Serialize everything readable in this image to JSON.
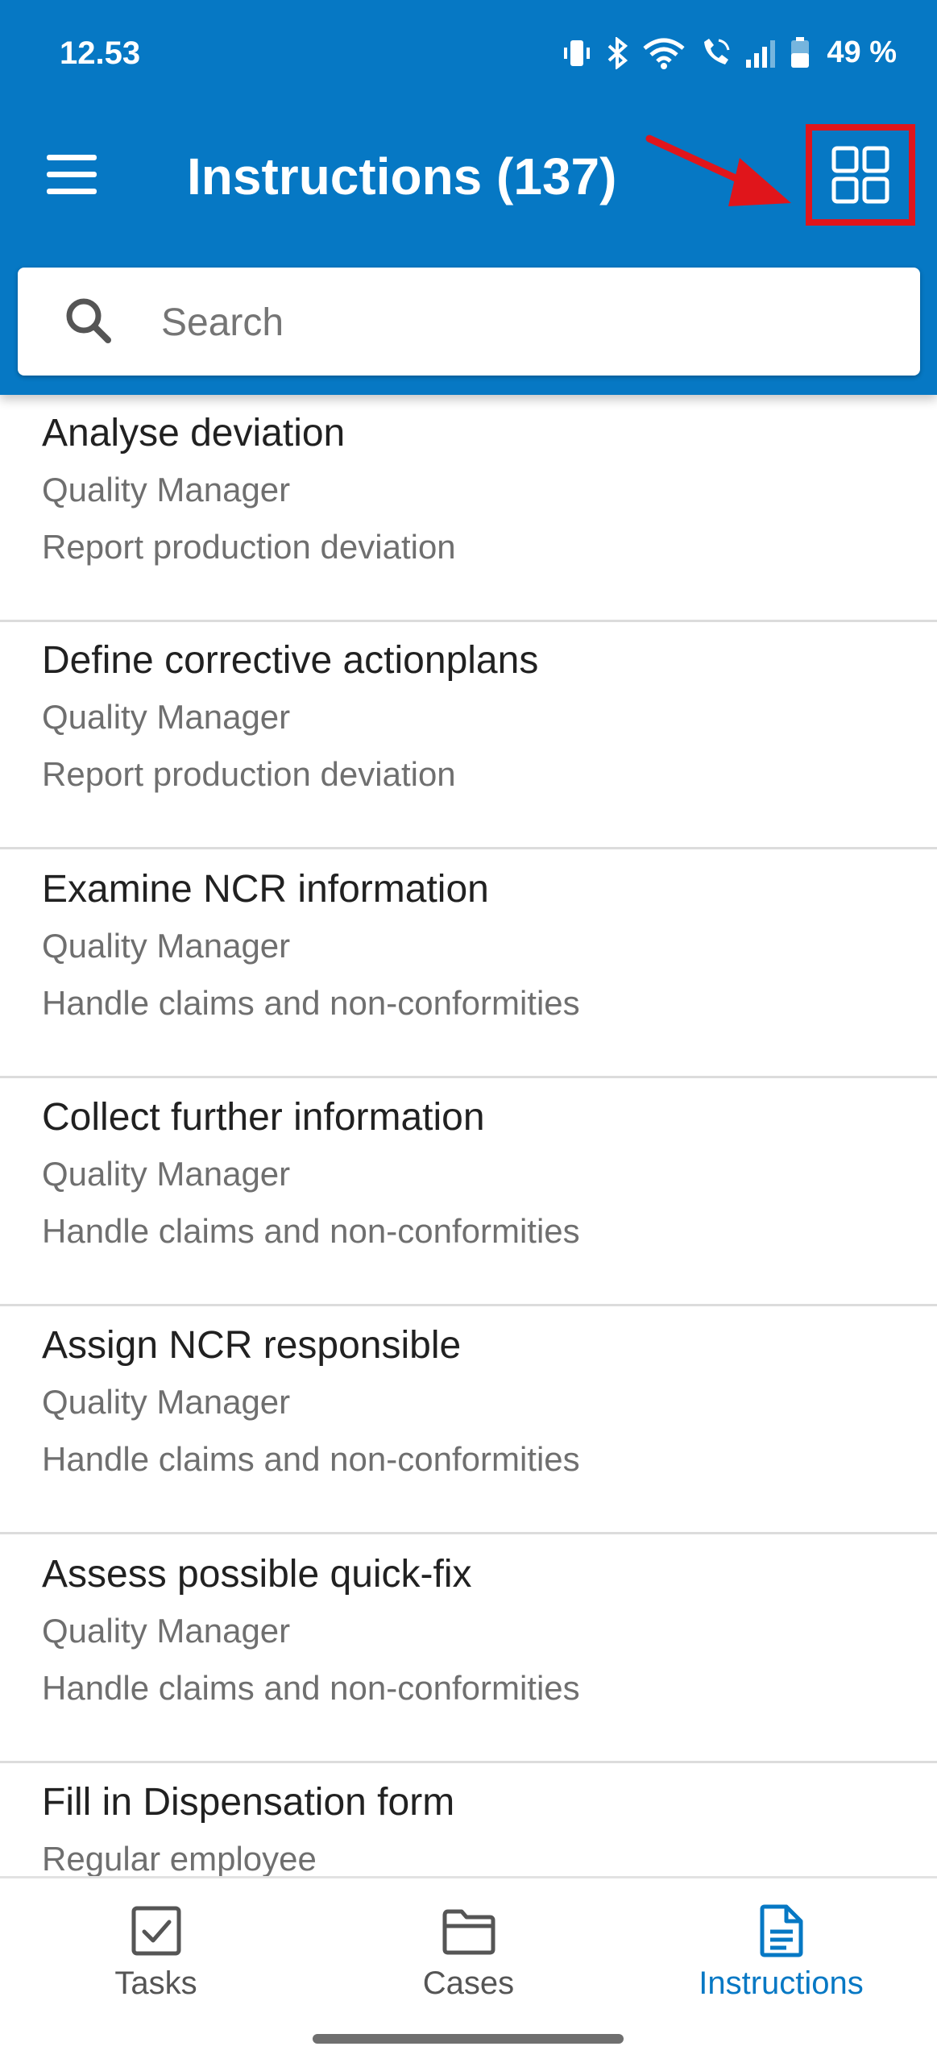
{
  "status_bar": {
    "time": "12.53",
    "battery": "49 %",
    "icons": [
      "vibrate-icon",
      "bluetooth-icon",
      "wifi-icon",
      "wifi-calling-icon",
      "signal-icon",
      "battery-icon"
    ]
  },
  "app_bar": {
    "title": "Instructions (137)",
    "menu_icon": "hamburger-menu-icon",
    "view_toggle_icon": "grid-view-icon",
    "annotation": {
      "arrow_color": "#e0151b",
      "highlight_color": "#e0151b"
    }
  },
  "search": {
    "placeholder": "Search",
    "value": ""
  },
  "instructions": [
    {
      "title": "Analyse deviation",
      "role": "Quality Manager",
      "process": "Report production deviation"
    },
    {
      "title": "Define corrective actionplans",
      "role": "Quality Manager",
      "process": "Report production deviation"
    },
    {
      "title": "Examine NCR information",
      "role": "Quality Manager",
      "process": "Handle claims and non-conformities"
    },
    {
      "title": "Collect further information",
      "role": "Quality Manager",
      "process": "Handle claims and non-conformities"
    },
    {
      "title": "Assign NCR responsible",
      "role": "Quality Manager",
      "process": "Handle claims and non-conformities"
    },
    {
      "title": "Assess possible quick-fix",
      "role": "Quality Manager",
      "process": "Handle claims and non-conformities"
    },
    {
      "title": "Fill in Dispensation form",
      "role": "Regular employee",
      "process": ""
    }
  ],
  "bottom_nav": {
    "items": [
      {
        "label": "Tasks",
        "icon": "checkbox-icon",
        "active": false
      },
      {
        "label": "Cases",
        "icon": "folder-icon",
        "active": false
      },
      {
        "label": "Instructions",
        "icon": "document-icon",
        "active": true
      }
    ]
  },
  "colors": {
    "primary": "#0678c4",
    "annotation_red": "#e0151b",
    "secondary_text": "#6f6f6f",
    "divider": "#dcdcdc"
  }
}
